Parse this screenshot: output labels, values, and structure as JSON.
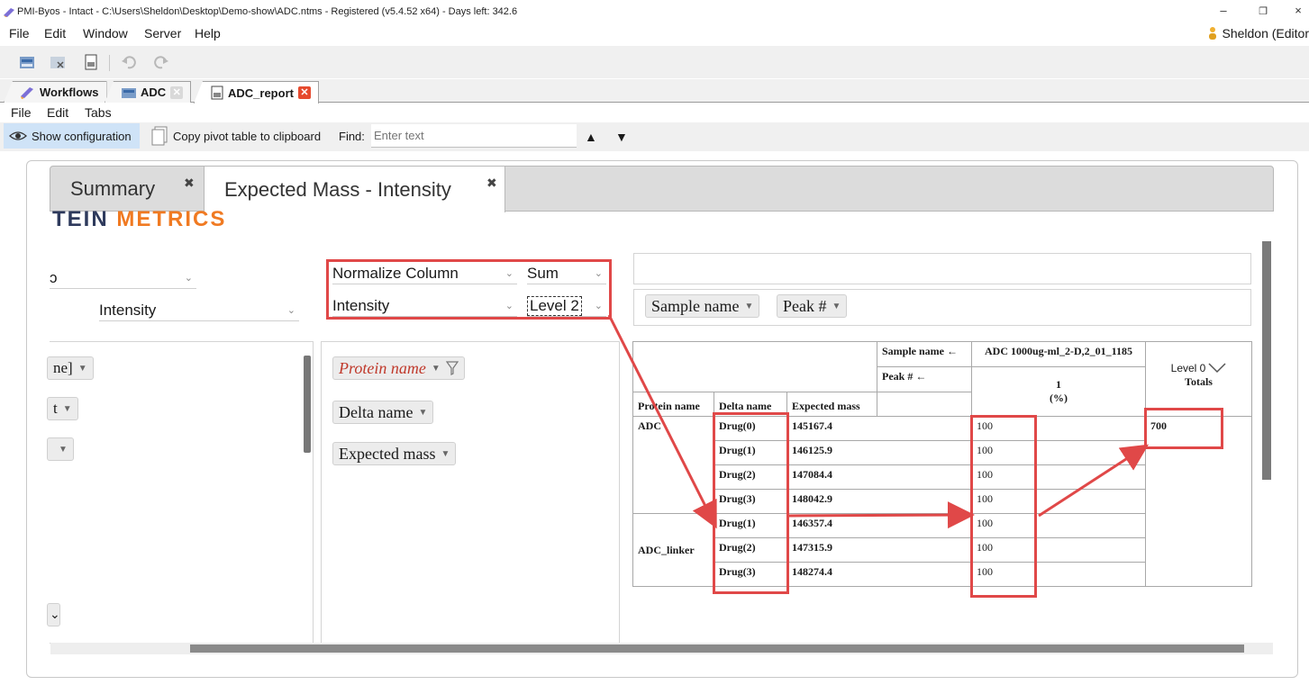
{
  "window": {
    "title": "PMI-Byos - Intact - C:\\Users\\Sheldon\\Desktop\\Demo-show\\ADC.ntms - Registered (v5.4.52 x64) - Days left: 342.6",
    "minimize": "–",
    "restore": "❐",
    "close": "×"
  },
  "menu": [
    "File",
    "Edit",
    "Window",
    "Server",
    "Help"
  ],
  "user": "Sheldon (Editor",
  "app_tabs": [
    {
      "label": "Workflows"
    },
    {
      "label": "ADC"
    },
    {
      "label": "ADC_report"
    }
  ],
  "sub_menu": [
    "File",
    "Edit",
    "Tabs"
  ],
  "subtoolbar": {
    "show_config": "Show configuration",
    "copy_pivot": "Copy pivot table to clipboard",
    "find_label": "Find:",
    "find_placeholder": "Enter text",
    "up": "▲",
    "down": "▼"
  },
  "report_tabs": [
    {
      "label": "Summary",
      "close": "✖"
    },
    {
      "label": "Expected Mass - Intensity",
      "close": "✖"
    }
  ],
  "logo": {
    "part1": "TEIN ",
    "part2": "METRICS"
  },
  "left_selects": {
    "first": "ɔ",
    "second": "Intensity"
  },
  "pivot_selects": {
    "normalize": "Normalize Column",
    "agg": "Sum",
    "value": "Intensity",
    "level": "Level 2"
  },
  "left_pills": [
    "ne]",
    "t",
    ""
  ],
  "bottom_left_chev": "⌄",
  "row_pills": {
    "protein": "Protein name",
    "delta": "Delta name",
    "mass": "Expected mass"
  },
  "col_pills": {
    "sample": "Sample name",
    "peak": "Peak #"
  },
  "table": {
    "sample_name_hdr": "Sample name ←",
    "peak_hdr": "Peak # ←",
    "sample": "ADC 1000ug-ml_2-D,2_01_1185",
    "peak_val": "1",
    "pct": "(%)",
    "level0": "Level 0",
    "totals": "Totals",
    "col_protein": "Protein name",
    "col_delta": "Delta name",
    "col_mass": "Expected mass",
    "total_value": "700",
    "groups": [
      {
        "protein": "ADC",
        "rows": [
          {
            "delta": "Drug(0)",
            "mass": "145167.4",
            "value": "100"
          },
          {
            "delta": "Drug(1)",
            "mass": "146125.9",
            "value": "100"
          },
          {
            "delta": "Drug(2)",
            "mass": "147084.4",
            "value": "100"
          },
          {
            "delta": "Drug(3)",
            "mass": "148042.9",
            "value": "100"
          }
        ]
      },
      {
        "protein": "ADC_linker",
        "rows": [
          {
            "delta": "Drug(1)",
            "mass": "146357.4",
            "value": "100"
          },
          {
            "delta": "Drug(2)",
            "mass": "147315.9",
            "value": "100"
          },
          {
            "delta": "Drug(3)",
            "mass": "148274.4",
            "value": "100"
          }
        ]
      }
    ]
  },
  "colors": {
    "annotation": "#e04848",
    "logo_dark": "#2e3a5c",
    "logo_orange": "#f07a22",
    "protein_pill_text": "#c0392b"
  }
}
